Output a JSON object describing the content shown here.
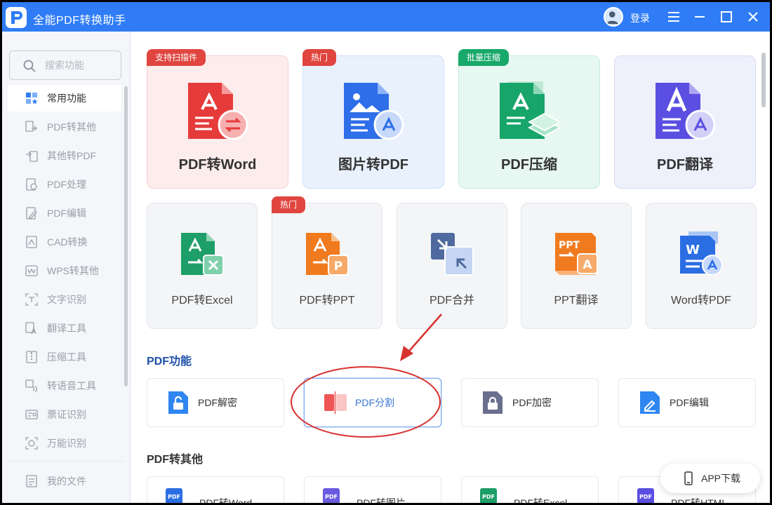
{
  "titlebar": {
    "title": "全能PDF转换助手",
    "login": "登录"
  },
  "sidebar": {
    "search_placeholder": "搜索功能",
    "items": [
      {
        "label": "常用功能",
        "icon": "star-grid-icon"
      },
      {
        "label": "PDF转其他",
        "icon": "pdf-convert-icon"
      },
      {
        "label": "其他转PDF",
        "icon": "to-pdf-icon"
      },
      {
        "label": "PDF处理",
        "icon": "pdf-process-icon"
      },
      {
        "label": "PDF编辑",
        "icon": "pdf-edit-icon"
      },
      {
        "label": "CAD转换",
        "icon": "cad-icon"
      },
      {
        "label": "WPS转其他",
        "icon": "wps-icon"
      },
      {
        "label": "文字识别",
        "icon": "ocr-icon"
      },
      {
        "label": "翻译工具",
        "icon": "translate-icon"
      },
      {
        "label": "压缩工具",
        "icon": "compress-icon"
      },
      {
        "label": "转语音工具",
        "icon": "voice-icon"
      },
      {
        "label": "票证识别",
        "icon": "ticket-icon"
      },
      {
        "label": "万能识别",
        "icon": "universal-icon"
      }
    ],
    "my_files": "我的文件"
  },
  "top_cards": [
    {
      "label": "PDF转Word",
      "tag": "支持扫描件"
    },
    {
      "label": "图片转PDF",
      "tag": "热门"
    },
    {
      "label": "PDF压缩",
      "tag": "批量压缩"
    },
    {
      "label": "PDF翻译",
      "tag": ""
    }
  ],
  "mid_cards": [
    {
      "label": "PDF转Excel",
      "tag": ""
    },
    {
      "label": "PDF转PPT",
      "tag": "热门"
    },
    {
      "label": "PDF合并",
      "tag": ""
    },
    {
      "label": "PPT翻译",
      "tag": ""
    },
    {
      "label": "Word转PDF",
      "tag": ""
    }
  ],
  "pdf_functions": {
    "title": "PDF功能",
    "items": [
      {
        "label": "PDF解密"
      },
      {
        "label": "PDF分割"
      },
      {
        "label": "PDF加密"
      },
      {
        "label": "PDF编辑"
      }
    ]
  },
  "pdf_to_other": {
    "title": "PDF转其他",
    "items": [
      {
        "label": "PDF转Word"
      },
      {
        "label": "PDF转图片"
      },
      {
        "label": "PDF转Excel"
      },
      {
        "label": "PDF转HTML"
      }
    ]
  },
  "app_download": "APP下载",
  "icon_text": {
    "pdf": "PDF",
    "ppt": "PPT",
    "w": "W",
    "p": "P",
    "a": "A",
    "x": "X"
  },
  "colors": {
    "titlebar": "#2f7cf6",
    "red_tag": "#e0453f",
    "green_tag": "#18a86a",
    "accent": "#3b76d8"
  }
}
